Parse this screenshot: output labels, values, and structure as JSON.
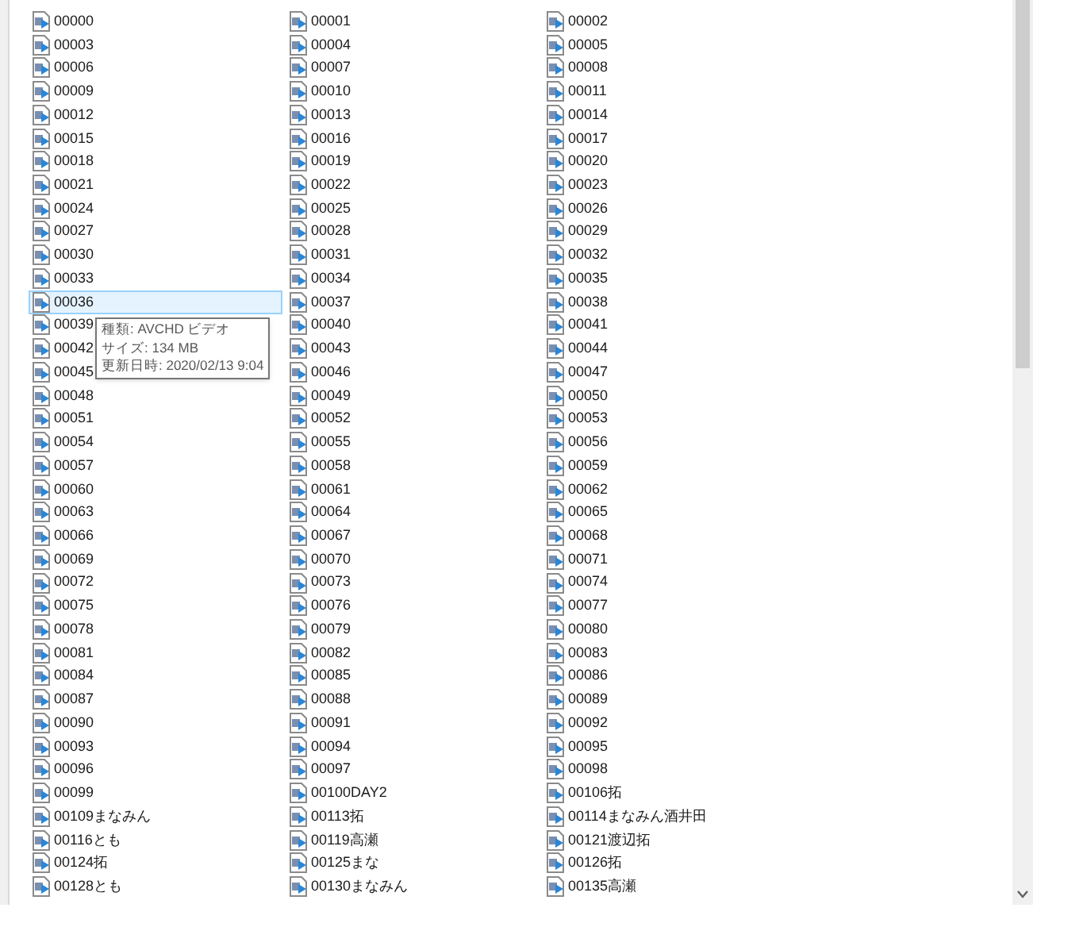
{
  "files": [
    {
      "name": "00000",
      "selected": false
    },
    {
      "name": "00001",
      "selected": false
    },
    {
      "name": "00002",
      "selected": false
    },
    {
      "name": "00003",
      "selected": false
    },
    {
      "name": "00004",
      "selected": false
    },
    {
      "name": "00005",
      "selected": false
    },
    {
      "name": "00006",
      "selected": false
    },
    {
      "name": "00007",
      "selected": false
    },
    {
      "name": "00008",
      "selected": false
    },
    {
      "name": "00009",
      "selected": false
    },
    {
      "name": "00010",
      "selected": false
    },
    {
      "name": "00011",
      "selected": false
    },
    {
      "name": "00012",
      "selected": false
    },
    {
      "name": "00013",
      "selected": false
    },
    {
      "name": "00014",
      "selected": false
    },
    {
      "name": "00015",
      "selected": false
    },
    {
      "name": "00016",
      "selected": false
    },
    {
      "name": "00017",
      "selected": false
    },
    {
      "name": "00018",
      "selected": false
    },
    {
      "name": "00019",
      "selected": false
    },
    {
      "name": "00020",
      "selected": false
    },
    {
      "name": "00021",
      "selected": false
    },
    {
      "name": "00022",
      "selected": false
    },
    {
      "name": "00023",
      "selected": false
    },
    {
      "name": "00024",
      "selected": false
    },
    {
      "name": "00025",
      "selected": false
    },
    {
      "name": "00026",
      "selected": false
    },
    {
      "name": "00027",
      "selected": false
    },
    {
      "name": "00028",
      "selected": false
    },
    {
      "name": "00029",
      "selected": false
    },
    {
      "name": "00030",
      "selected": false
    },
    {
      "name": "00031",
      "selected": false
    },
    {
      "name": "00032",
      "selected": false
    },
    {
      "name": "00033",
      "selected": false
    },
    {
      "name": "00034",
      "selected": false
    },
    {
      "name": "00035",
      "selected": false
    },
    {
      "name": "00036",
      "selected": true
    },
    {
      "name": "00037",
      "selected": false
    },
    {
      "name": "00038",
      "selected": false
    },
    {
      "name": "00039",
      "selected": false
    },
    {
      "name": "00040",
      "selected": false
    },
    {
      "name": "00041",
      "selected": false
    },
    {
      "name": "00042",
      "selected": false
    },
    {
      "name": "00043",
      "selected": false
    },
    {
      "name": "00044",
      "selected": false
    },
    {
      "name": "00045",
      "selected": false
    },
    {
      "name": "00046",
      "selected": false
    },
    {
      "name": "00047",
      "selected": false
    },
    {
      "name": "00048",
      "selected": false
    },
    {
      "name": "00049",
      "selected": false
    },
    {
      "name": "00050",
      "selected": false
    },
    {
      "name": "00051",
      "selected": false
    },
    {
      "name": "00052",
      "selected": false
    },
    {
      "name": "00053",
      "selected": false
    },
    {
      "name": "00054",
      "selected": false
    },
    {
      "name": "00055",
      "selected": false
    },
    {
      "name": "00056",
      "selected": false
    },
    {
      "name": "00057",
      "selected": false
    },
    {
      "name": "00058",
      "selected": false
    },
    {
      "name": "00059",
      "selected": false
    },
    {
      "name": "00060",
      "selected": false
    },
    {
      "name": "00061",
      "selected": false
    },
    {
      "name": "00062",
      "selected": false
    },
    {
      "name": "00063",
      "selected": false
    },
    {
      "name": "00064",
      "selected": false
    },
    {
      "name": "00065",
      "selected": false
    },
    {
      "name": "00066",
      "selected": false
    },
    {
      "name": "00067",
      "selected": false
    },
    {
      "name": "00068",
      "selected": false
    },
    {
      "name": "00069",
      "selected": false
    },
    {
      "name": "00070",
      "selected": false
    },
    {
      "name": "00071",
      "selected": false
    },
    {
      "name": "00072",
      "selected": false
    },
    {
      "name": "00073",
      "selected": false
    },
    {
      "name": "00074",
      "selected": false
    },
    {
      "name": "00075",
      "selected": false
    },
    {
      "name": "00076",
      "selected": false
    },
    {
      "name": "00077",
      "selected": false
    },
    {
      "name": "00078",
      "selected": false
    },
    {
      "name": "00079",
      "selected": false
    },
    {
      "name": "00080",
      "selected": false
    },
    {
      "name": "00081",
      "selected": false
    },
    {
      "name": "00082",
      "selected": false
    },
    {
      "name": "00083",
      "selected": false
    },
    {
      "name": "00084",
      "selected": false
    },
    {
      "name": "00085",
      "selected": false
    },
    {
      "name": "00086",
      "selected": false
    },
    {
      "name": "00087",
      "selected": false
    },
    {
      "name": "00088",
      "selected": false
    },
    {
      "name": "00089",
      "selected": false
    },
    {
      "name": "00090",
      "selected": false
    },
    {
      "name": "00091",
      "selected": false
    },
    {
      "name": "00092",
      "selected": false
    },
    {
      "name": "00093",
      "selected": false
    },
    {
      "name": "00094",
      "selected": false
    },
    {
      "name": "00095",
      "selected": false
    },
    {
      "name": "00096",
      "selected": false
    },
    {
      "name": "00097",
      "selected": false
    },
    {
      "name": "00098",
      "selected": false
    },
    {
      "name": "00099",
      "selected": false
    },
    {
      "name": "00100DAY2",
      "selected": false
    },
    {
      "name": "00106拓",
      "selected": false
    },
    {
      "name": "00109まなみん",
      "selected": false
    },
    {
      "name": "00113拓",
      "selected": false
    },
    {
      "name": "00114まなみん酒井田",
      "selected": false
    },
    {
      "name": "00116とも",
      "selected": false
    },
    {
      "name": "00119高瀬",
      "selected": false
    },
    {
      "name": "00121渡辺拓",
      "selected": false
    },
    {
      "name": "00124拓",
      "selected": false
    },
    {
      "name": "00125まな",
      "selected": false
    },
    {
      "name": "00126拓",
      "selected": false
    },
    {
      "name": "00128とも",
      "selected": false
    },
    {
      "name": "00130まなみん",
      "selected": false
    },
    {
      "name": "00135高瀬",
      "selected": false
    }
  ],
  "tooltip": {
    "lines": [
      "種類: AVCHD ビデオ",
      "サイズ: 134 MB",
      "更新日時: 2020/02/13 9:04"
    ]
  }
}
